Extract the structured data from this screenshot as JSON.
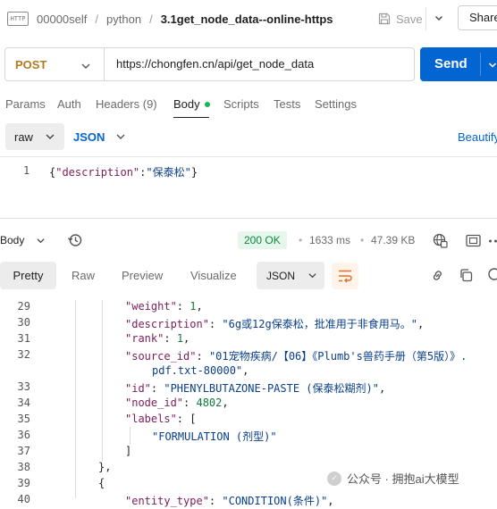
{
  "header": {
    "http_badge": "HTTP",
    "breadcrumb": [
      "00000self",
      "python",
      "3.1get_node_data--online-https"
    ],
    "separator": "/",
    "save_label": "Save",
    "share_label": "Share"
  },
  "request": {
    "method": "POST",
    "url": "https://chongfen.cn/api/get_node_data",
    "send_label": "Send"
  },
  "request_tabs": [
    "Params",
    "Auth",
    "Headers (9)",
    "Body",
    "Scripts",
    "Tests",
    "Settings"
  ],
  "body_type": {
    "mode": "raw",
    "language": "JSON",
    "beautify_label": "Beautify"
  },
  "editor": {
    "line_number": "1",
    "open": "{",
    "key": "\"description\"",
    "colon": ":",
    "value": "\"保泰松\"",
    "close": "}"
  },
  "response": {
    "section_label": "Body",
    "status": "200 OK",
    "time": "1633 ms",
    "size": "47.39 KB",
    "view_tabs": [
      "Pretty",
      "Raw",
      "Preview",
      "Visualize"
    ],
    "format": "JSON"
  },
  "code_lines": [
    {
      "n": "29",
      "indent": 140,
      "parts": [
        [
          "k",
          "\"weight\""
        ],
        [
          "p",
          ": "
        ],
        [
          "num",
          "1"
        ],
        [
          "p",
          ","
        ]
      ]
    },
    {
      "n": "30",
      "indent": 140,
      "parts": [
        [
          "k",
          "\"description\""
        ],
        [
          "p",
          ": "
        ],
        [
          "s",
          "\"6g或12g保泰松，批准用于非食用马。\""
        ],
        [
          "p",
          ","
        ]
      ]
    },
    {
      "n": "31",
      "indent": 140,
      "parts": [
        [
          "k",
          "\"rank\""
        ],
        [
          "p",
          ": "
        ],
        [
          "num",
          "1"
        ],
        [
          "p",
          ","
        ]
      ]
    },
    {
      "n": "32",
      "indent": 140,
      "parts": [
        [
          "k",
          "\"source_id\""
        ],
        [
          "p",
          ": "
        ],
        [
          "s",
          "\"01宠物疾病/【06】《Plumb's兽药手册（第5版）》."
        ]
      ]
    },
    {
      "n": "",
      "indent": 170,
      "parts": [
        [
          "s",
          "pdf.txt-80000\""
        ],
        [
          "p",
          ","
        ]
      ]
    },
    {
      "n": "33",
      "indent": 140,
      "parts": [
        [
          "k",
          "\"id\""
        ],
        [
          "p",
          ": "
        ],
        [
          "s",
          "\"PHENYLBUTAZONE-PASTE (保泰松糊剂)\""
        ],
        [
          "p",
          ","
        ]
      ]
    },
    {
      "n": "34",
      "indent": 140,
      "parts": [
        [
          "k",
          "\"node_id\""
        ],
        [
          "p",
          ": "
        ],
        [
          "num",
          "4802"
        ],
        [
          "p",
          ","
        ]
      ]
    },
    {
      "n": "35",
      "indent": 140,
      "parts": [
        [
          "k",
          "\"labels\""
        ],
        [
          "p",
          ": ["
        ]
      ]
    },
    {
      "n": "36",
      "indent": 170,
      "parts": [
        [
          "s",
          "\"FORMULATION (剂型)\""
        ]
      ]
    },
    {
      "n": "37",
      "indent": 140,
      "parts": [
        [
          "p",
          "]"
        ]
      ]
    },
    {
      "n": "38",
      "indent": 110,
      "parts": [
        [
          "p",
          "},"
        ]
      ]
    },
    {
      "n": "39",
      "indent": 110,
      "parts": [
        [
          "p",
          "{"
        ]
      ]
    },
    {
      "n": "40",
      "indent": 140,
      "parts": [
        [
          "k",
          "\"entity_type\""
        ],
        [
          "p",
          ": "
        ],
        [
          "s",
          "\"CONDITION(条件)\""
        ],
        [
          "p",
          ","
        ]
      ]
    }
  ],
  "watermark": {
    "text": "公众号 · 拥抱ai大模型",
    "logo": "✓"
  },
  "icons": [
    "http-icon",
    "save-icon",
    "chevron-down-icon",
    "history-icon",
    "globe-icon",
    "screenshot-icon",
    "more-icon",
    "wrap-lines-icon",
    "link-icon",
    "copy-icon",
    "search-icon"
  ],
  "colors": {
    "accent": "#0265d2",
    "post": "#b5791e",
    "status_ok": "#0a8a3a",
    "tab_dot": "#0cbb52"
  }
}
